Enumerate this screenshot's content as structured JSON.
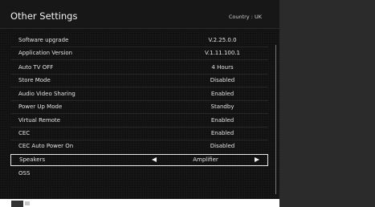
{
  "header": {
    "title": "Other Settings",
    "country": "Country : UK"
  },
  "settings": [
    {
      "label": "Software upgrade",
      "value": "V.2.25.0.0"
    },
    {
      "label": "Application Version",
      "value": "V.1.11.100.1"
    },
    {
      "label": "Auto TV OFF",
      "value": "4 Hours"
    },
    {
      "label": "Store Mode",
      "value": "Disabled"
    },
    {
      "label": "Audio Video Sharing",
      "value": "Enabled"
    },
    {
      "label": "Power Up Mode",
      "value": "Standby"
    },
    {
      "label": "Virtual Remote",
      "value": "Enabled"
    },
    {
      "label": "CEC",
      "value": "Enabled"
    },
    {
      "label": "CEC Auto Power On",
      "value": "Disabled"
    },
    {
      "label": "Speakers",
      "value": "Amplifier",
      "selected": true
    },
    {
      "label": "OSS",
      "value": ""
    }
  ],
  "colors": {
    "background": "#121212",
    "highlight_border": "#e9e9e9",
    "side_panel": "#2b2b2b"
  }
}
